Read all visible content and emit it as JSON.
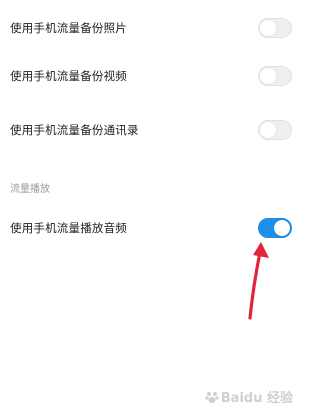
{
  "settings": {
    "backup_photos": {
      "label": "使用手机流量备份照片",
      "enabled": false
    },
    "backup_videos": {
      "label": "使用手机流量备份视频",
      "enabled": false
    },
    "backup_contacts": {
      "label": "使用手机流量备份通讯录",
      "enabled": false
    }
  },
  "playback_section": {
    "header": "流量播放",
    "play_audio": {
      "label": "使用手机流量播放音频",
      "enabled": true
    }
  },
  "colors": {
    "toggle_on": "#1f8ee8",
    "toggle_off": "#efefef",
    "arrow": "#e0243a"
  },
  "watermark": {
    "text": "Baidu 经验"
  },
  "icons": {
    "arrow": "red-arrow-pointing-up-icon",
    "watermark": "baidu-paw-logo"
  }
}
